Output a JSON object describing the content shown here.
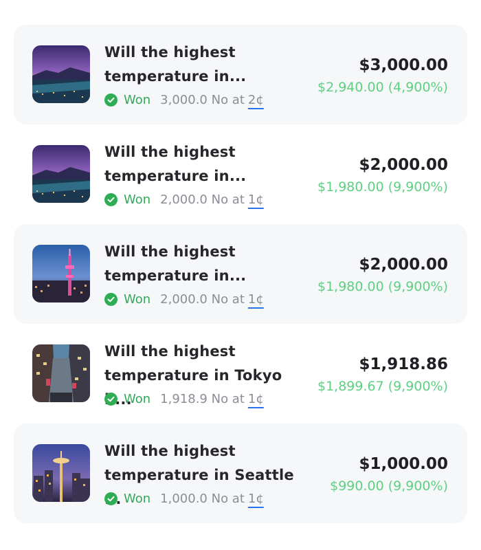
{
  "positions": [
    {
      "title_line1": "Will the highest",
      "title_line2": "temperature in...",
      "status": "Won",
      "shares_text": "3,000.0 No at",
      "price": "2¢",
      "amount": "$3,000.00",
      "profit": "$2,940.00 (4,900%)",
      "image_icon": "city-night-skyline-icon"
    },
    {
      "title_line1": "Will the highest",
      "title_line2": "temperature in...",
      "status": "Won",
      "shares_text": "2,000.0 No at",
      "price": "1¢",
      "amount": "$2,000.00",
      "profit": "$1,980.00 (9,900%)",
      "image_icon": "city-night-skyline-icon"
    },
    {
      "title_line1": "Will the highest",
      "title_line2": "temperature in...",
      "status": "Won",
      "shares_text": "2,000.0 No at",
      "price": "1¢",
      "amount": "$2,000.00",
      "profit": "$1,980.00 (9,900%)",
      "image_icon": "tower-cityscape-icon"
    },
    {
      "title_line1": "Will the highest",
      "title_line2": "temperature in Tokyo b...",
      "status": "Won",
      "shares_text": "1,918.9 No at",
      "price": "1¢",
      "amount": "$1,918.86",
      "profit": "$1,899.67 (9,900%)",
      "image_icon": "city-street-icon"
    },
    {
      "title_line1": "Will the highest",
      "title_line2": "temperature in Seattle ...",
      "status": "Won",
      "shares_text": "1,000.0 No at",
      "price": "1¢",
      "amount": "$1,000.00",
      "profit": "$990.00 (9,900%)",
      "image_icon": "space-needle-skyline-icon"
    }
  ],
  "colors": {
    "won_green": "#34a85a",
    "profit_green": "#5fcf82",
    "underline_blue": "#2a73ea",
    "row_shade": "#f6f7f9"
  }
}
